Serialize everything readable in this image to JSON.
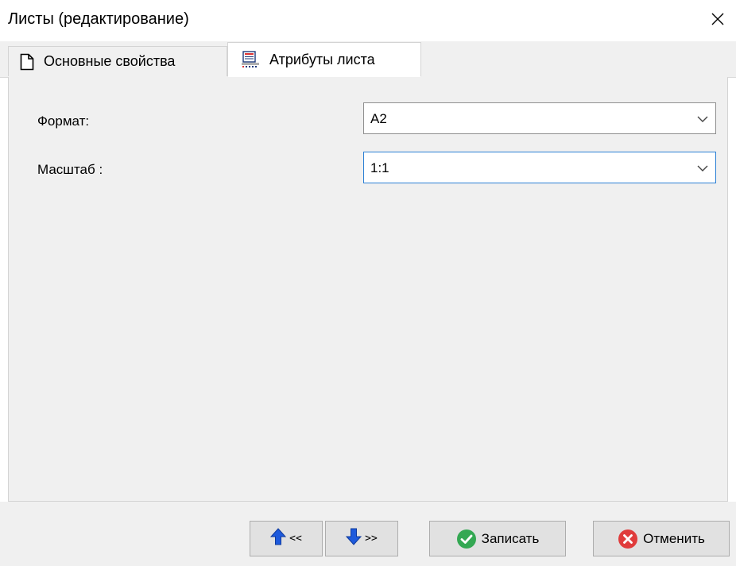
{
  "window": {
    "title": "Листы (редактирование)",
    "close_icon": "close-icon"
  },
  "tabs": [
    {
      "label": "Основные свойства",
      "icon": "document-icon",
      "active": false
    },
    {
      "label": "Атрибуты листа",
      "icon": "sheet-attributes-icon",
      "active": true
    }
  ],
  "form": {
    "format_label": "Формат:",
    "format_value": "A2",
    "scale_label": "Масштаб :",
    "scale_value": "1:1"
  },
  "footer": {
    "prev_label": "<<",
    "next_label": ">>",
    "save_label": "Записать",
    "cancel_label": "Отменить"
  },
  "colors": {
    "accent_focus": "#2a7fd4",
    "nav_arrow": "#1e5adc",
    "save_green": "#34a853",
    "cancel_red": "#e03c3c"
  }
}
